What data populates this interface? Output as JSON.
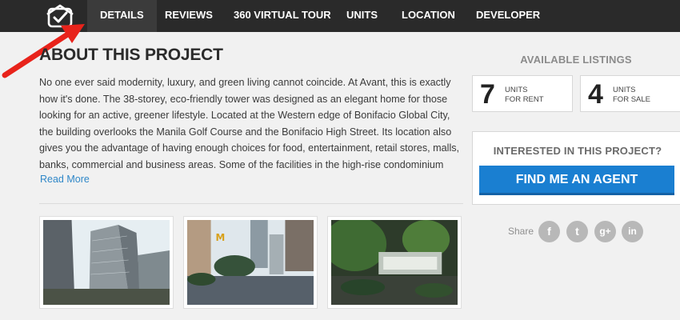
{
  "nav": {
    "logo_icon": "house-check-icon",
    "items": [
      {
        "label": "DETAILS",
        "active": true
      },
      {
        "label": "REVIEWS"
      },
      {
        "label": "360 VIRTUAL TOUR"
      },
      {
        "label": "UNITS"
      },
      {
        "label": "LOCATION"
      },
      {
        "label": "DEVELOPER"
      }
    ]
  },
  "annotation": {
    "icon": "red-arrow-icon",
    "color": "#e8231b"
  },
  "about": {
    "title": "ABOUT THIS PROJECT",
    "text": "No one ever said modernity, luxury, and green living cannot coincide. At Avant, this is exactly how it's done. The 38-storey, eco-friendly tower was designed as an elegant home for those looking for an active, greener lifestyle. Located at the Western edge of Bonifacio Global City, the building overlooks the Manila Golf Course and the Bonifacio High Street. Its location also gives you the advantage of having enough choices for food, entertainment, retail stores, malls, banks, commercial and business areas. Some of the facilities in the high-rise condominium include a",
    "read_more": "Read More"
  },
  "gallery": [
    {
      "icon": "tower-photo"
    },
    {
      "icon": "street-photo"
    },
    {
      "icon": "garden-photo"
    }
  ],
  "sidebar": {
    "available_title": "AVAILABLE LISTINGS",
    "listings": [
      {
        "count": "7",
        "line1": "UNITS",
        "line2": "FOR RENT"
      },
      {
        "count": "4",
        "line1": "UNITS",
        "line2": "FOR SALE"
      }
    ],
    "interest_title": "INTERESTED IN THIS PROJECT?",
    "agent_button": "FIND ME AN AGENT",
    "share_label": "Share",
    "share_icons": [
      {
        "name": "facebook-icon",
        "glyph": "f"
      },
      {
        "name": "twitter-icon",
        "glyph": "t"
      },
      {
        "name": "google-plus-icon",
        "glyph": "g+"
      },
      {
        "name": "linkedin-icon",
        "glyph": "in"
      }
    ]
  },
  "colors": {
    "nav_bg": "#2a2a2a",
    "accent": "#1a7fd1",
    "link": "#2f87c8"
  }
}
